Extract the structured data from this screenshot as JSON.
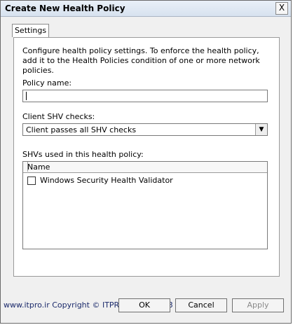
{
  "window": {
    "title": "Create New Health Policy",
    "close_label": "X"
  },
  "tabs": [
    {
      "label": "Settings"
    }
  ],
  "settings": {
    "description": "Configure health policy settings. To enforce the health policy, add it to the Health Policies condition of one or more network policies.",
    "policy_name_label": "Policy name:",
    "policy_name_value": "",
    "client_shv_label": "Client SHV checks:",
    "client_shv_selected": "Client passes all SHV checks",
    "shvs_label": "SHVs used in this health policy:",
    "shv_list": {
      "column_header": "Name",
      "items": [
        {
          "label": "Windows Security Health Validator",
          "checked": false
        }
      ]
    }
  },
  "buttons": {
    "ok": "OK",
    "cancel": "Cancel",
    "apply": "Apply"
  },
  "watermark": "www.itpro.ir  Copyright © ITPRO.COM - 2013 (ITPro.ir)"
}
